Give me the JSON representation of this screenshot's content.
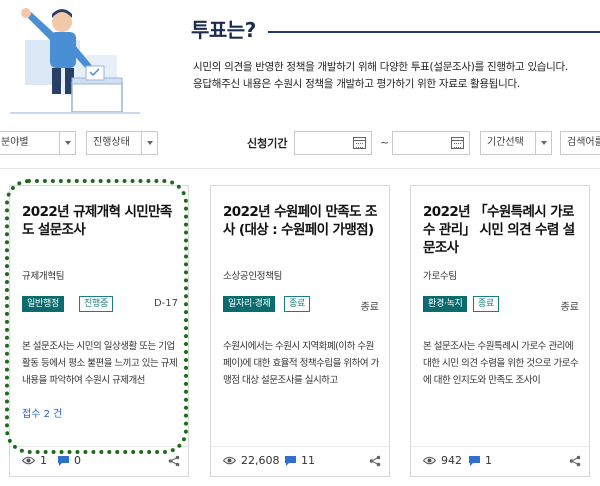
{
  "hero": {
    "title": "투표는?",
    "desc_line1": "시민의 의견을 반영한 정책을 개발하기 위해 다양한 투표(설문조사)를 진행하고 있습니다.",
    "desc_line2": "응답해주신 내용은 수원시 정책을 개발하고 평가하기 위한 자료로 활용됩니다."
  },
  "filters": {
    "category": "분야별",
    "state": "진행상태",
    "period_label": "신청기간",
    "tilde": "~",
    "period_select": "기간선택",
    "search_select": "검색어를"
  },
  "cards": [
    {
      "title": "2022년 규제개혁 시민만족도 설문조사",
      "dept": "규제개혁팀",
      "tag1": "일반행정",
      "tag2": "진행중",
      "status": "D-17",
      "summary": "본 설문조사는 시민의 일상생활 또는 기업활동 등에서 평소 불편을 느끼고 있는 규제내용을 파악하여 수원시 규제개선",
      "count_link": "접수 2 건",
      "views": "1",
      "comments": "0"
    },
    {
      "title": "2022년 수원페이 만족도 조사 (대상 : 수원페이 가맹점)",
      "dept": "소상공인정책팀",
      "tag1": "일자리·경제",
      "tag2": "종료",
      "status": "종료",
      "summary": "수원시에서는 수원시 지역화폐(이하 수원페이)에 대한 효율적 정책수립을 위하여 가맹점 대상 설문조사를 실시하고",
      "views": "22,608",
      "comments": "11"
    },
    {
      "title": "2022년 「수원특례시 가로수 관리」 시민 의견 수렴 설문조사",
      "dept": "가로수팀",
      "tag1": "환경·녹지",
      "tag2": "종료",
      "status": "종료",
      "summary": "본 설문조사는 수원특례시 가로수 관리에 대한 시민 의견 수렴을 위한 것으로 가로수에 대한 인지도와 만족도 조사이",
      "views": "942",
      "comments": "1"
    }
  ],
  "colors": {
    "accent_teal": "#0b6b6e",
    "link_blue": "#2b5fbf",
    "highlight_green": "#1e6b1e",
    "title_navy": "#1d2b50"
  },
  "icons": [
    "eye-icon",
    "comment-icon",
    "share-icon",
    "calendar-icon",
    "chevron-down-icon",
    "voting-illustration"
  ]
}
